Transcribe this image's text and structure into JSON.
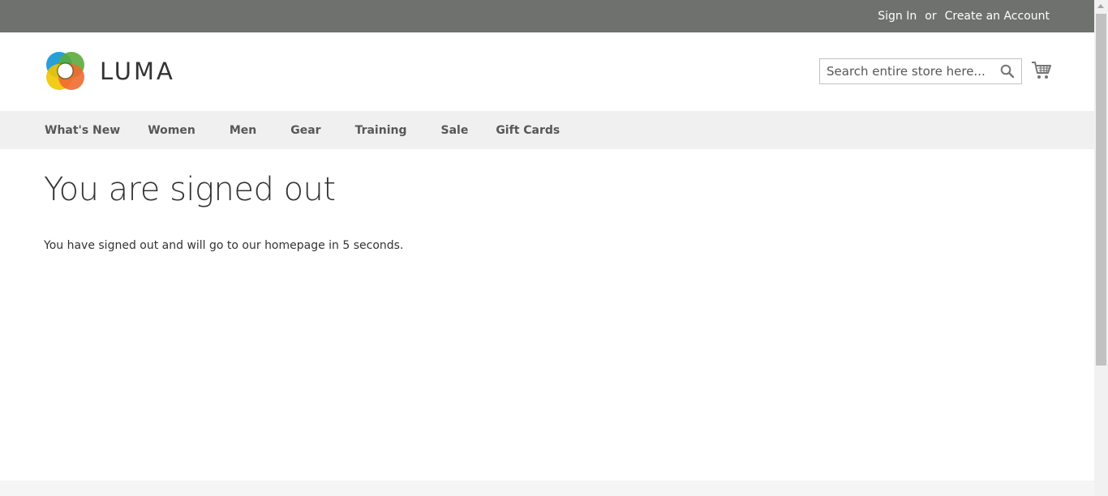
{
  "header": {
    "sign_in": "Sign In",
    "or": "or",
    "create_account": "Create an Account"
  },
  "logo": {
    "text": "LUMA"
  },
  "search": {
    "placeholder": "Search entire store here..."
  },
  "nav": {
    "items": [
      {
        "label": "What's New"
      },
      {
        "label": "Women"
      },
      {
        "label": "Men"
      },
      {
        "label": "Gear"
      },
      {
        "label": "Training"
      },
      {
        "label": "Sale"
      },
      {
        "label": "Gift Cards"
      }
    ]
  },
  "main": {
    "title": "You are signed out",
    "message": "You have signed out and will go to our homepage in 5 seconds."
  },
  "colors": {
    "top_bar": "#6e716e",
    "nav_bg": "#f0f0f0",
    "text": "#333333"
  }
}
